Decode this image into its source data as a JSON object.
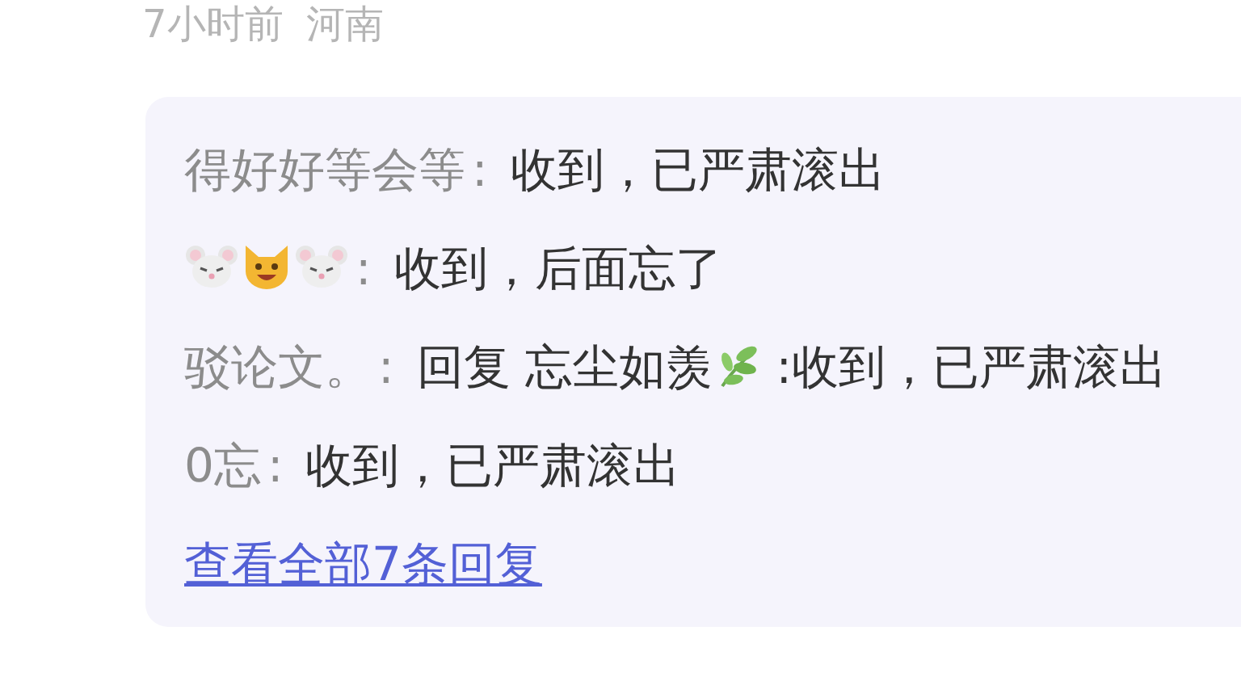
{
  "meta": {
    "time": "7小时前",
    "location": "河南"
  },
  "replies": [
    {
      "author": [
        {
          "kind": "text",
          "text": "得好好等会等"
        }
      ],
      "separator": ":",
      "content": [
        {
          "kind": "text",
          "text": "收到，已严肃滚出"
        }
      ]
    },
    {
      "author": [
        {
          "kind": "mouse"
        },
        {
          "kind": "cat"
        },
        {
          "kind": "mouse"
        }
      ],
      "separator": ":",
      "content": [
        {
          "kind": "text",
          "text": "收到，后面忘了"
        }
      ]
    },
    {
      "author": [
        {
          "kind": "text",
          "text": "驳论文。"
        }
      ],
      "separator": ":",
      "content": [
        {
          "kind": "text",
          "text": "回复 忘尘如羡"
        },
        {
          "kind": "leaf"
        },
        {
          "kind": "text",
          "text": " :收到，已严肃滚出"
        }
      ]
    },
    {
      "author": [
        {
          "kind": "text",
          "text": "0忘"
        }
      ],
      "separator": ":",
      "content": [
        {
          "kind": "text",
          "text": "收到，已严肃滚出"
        }
      ]
    }
  ],
  "view_all": "查看全部7条回复"
}
